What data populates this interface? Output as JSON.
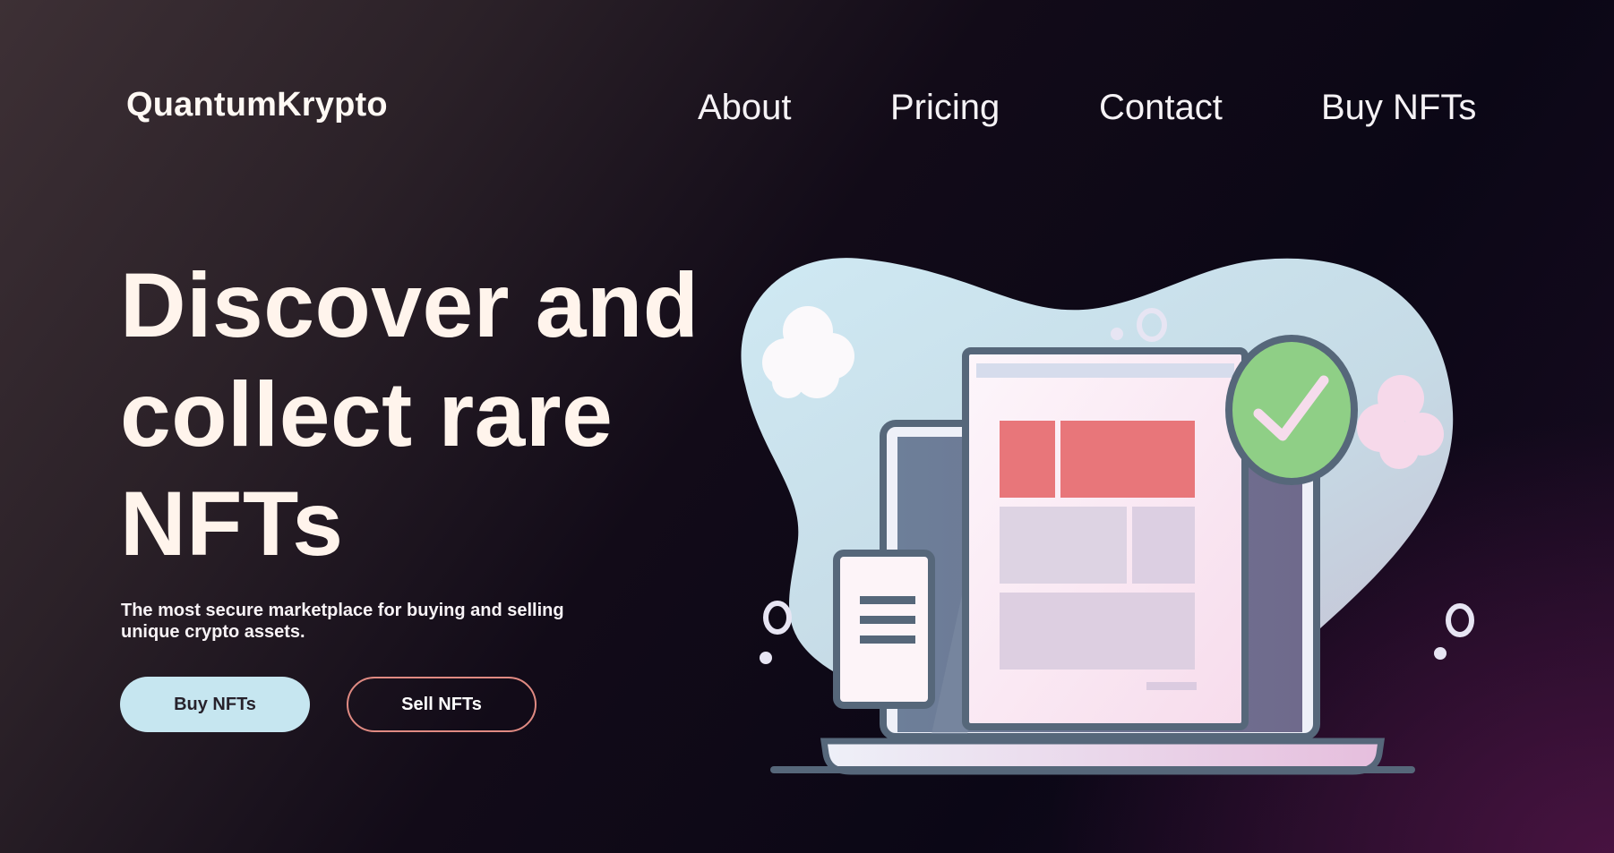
{
  "header": {
    "logo": "QuantumKrypto",
    "nav": [
      {
        "label": "About"
      },
      {
        "label": "Pricing"
      },
      {
        "label": "Contact"
      },
      {
        "label": "Buy NFTs"
      }
    ]
  },
  "hero": {
    "headline": "Discover and collect rare NFTs",
    "subtext": "The most secure marketplace for buying and selling unique crypto assets.",
    "primary_button": "Buy NFTs",
    "secondary_button": "Sell NFTs"
  },
  "colors": {
    "primary_button_bg": "#c6e6f0",
    "secondary_button_border": "#e08a82",
    "headline": "#fff4ec",
    "check_badge": "#8fcf86"
  },
  "illustration": {
    "icons": [
      "laptop-icon",
      "webpage-icon",
      "phone-icon",
      "checkmark-icon",
      "cloud-icon"
    ]
  }
}
